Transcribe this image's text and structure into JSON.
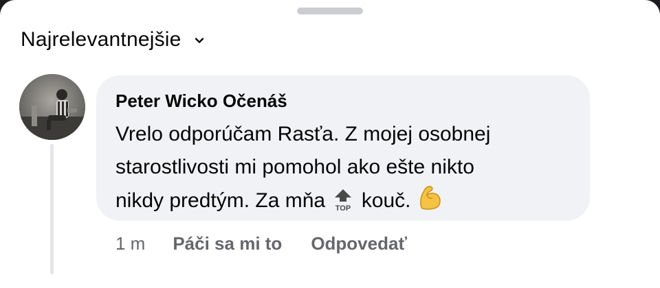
{
  "sort": {
    "label": "Najrelevantnejšie",
    "icon": "chevron-down-icon"
  },
  "comment": {
    "author": "Peter Wicko Očenáš",
    "text_lines": [
      "Vrelo odporúčam Rasťa. Z mojej osobnej",
      "starostlivosti mi pomohol ako ešte nikto",
      "nikdy predtým. Za mňa",
      "kouč."
    ],
    "emoji": [
      "top-arrow-emoji",
      "flexed-biceps-emoji"
    ],
    "timestamp": "1 m",
    "like_label": "Páči sa mi to",
    "reply_label": "Odpovedať"
  },
  "colors": {
    "bubble": "#f0f2f5",
    "secondary_text": "#65676b",
    "primary_text": "#050505"
  }
}
